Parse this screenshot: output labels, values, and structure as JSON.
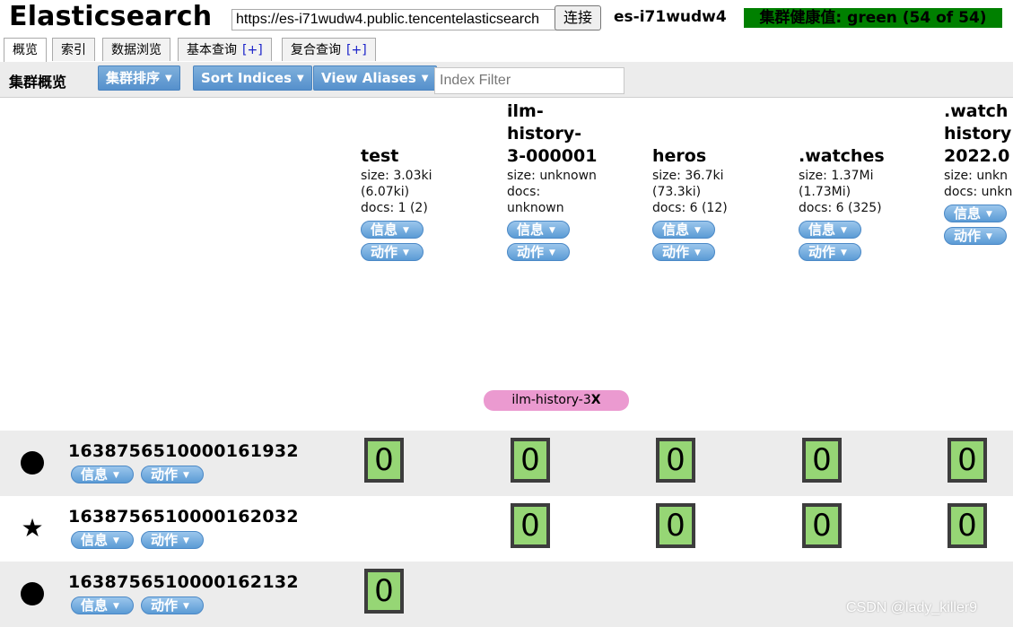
{
  "header": {
    "title": "Elasticsearch",
    "url": "https://es-i71wudw4.public.tencentelasticsearch",
    "connect_label": "连接",
    "cluster_name": "es-i71wudw4",
    "health": "集群健康值: green (54 of 54)",
    "health_color": "#008000"
  },
  "tabs": [
    {
      "label": "概览",
      "plus": ""
    },
    {
      "label": "索引",
      "plus": ""
    },
    {
      "label": "数据浏览",
      "plus": ""
    },
    {
      "label": "基本查询",
      "plus": "[+]"
    },
    {
      "label": "复合查询",
      "plus": "[+]"
    }
  ],
  "toolbar": {
    "title": "集群概览",
    "sort_cluster": "集群排序",
    "sort_indices": "Sort Indices",
    "view_aliases": "View Aliases",
    "filter_placeholder": "Index Filter"
  },
  "pill_labels": {
    "info": "信息",
    "action": "动作"
  },
  "indices": [
    {
      "name": "test",
      "size": "size: 3.03ki",
      "size_total": "(6.07ki)",
      "docs": "docs: 1 (2)"
    },
    {
      "name": "ilm-\nhistory-\n3-000001",
      "size": "size: unknown",
      "size_total": "",
      "docs": "docs:\nunknown"
    },
    {
      "name": "heros",
      "size": "size: 36.7ki",
      "size_total": "(73.3ki)",
      "docs": "docs: 6 (12)"
    },
    {
      "name": ".watches",
      "size": "size: 1.37Mi",
      "size_total": "(1.73Mi)",
      "docs": "docs: 6 (325)"
    },
    {
      "name": ".watch\nhistory\n2022.0",
      "size": "size: unkn",
      "size_total": "",
      "docs": "docs: unkn"
    }
  ],
  "alias": {
    "label": "ilm-history-3",
    "close": "X",
    "color": "#eb9ad0"
  },
  "nodes": [
    {
      "name": "1638756510000161932",
      "icon": "circle-icon",
      "shards": [
        "0",
        "0",
        "0",
        "0",
        "0"
      ]
    },
    {
      "name": "1638756510000162032",
      "icon": "star-icon",
      "shards": [
        "",
        "0",
        "0",
        "0",
        "0"
      ]
    },
    {
      "name": "1638756510000162132",
      "icon": "circle-icon",
      "shards": [
        "0",
        "",
        "",
        "",
        ""
      ]
    }
  ],
  "watermark": "CSDN @lady_killer9"
}
